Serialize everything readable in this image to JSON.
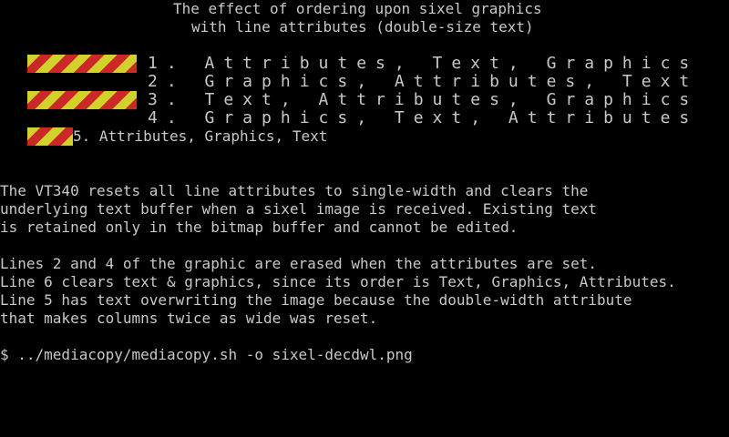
{
  "header": {
    "line1": "The effect of ordering upon sixel graphics",
    "line2": "with line attributes (double-size text)"
  },
  "demo": {
    "line1": "1. Attributes, Text, Graphics",
    "line2": "2. Graphics, Attributes, Text",
    "line3": "3. Text, Attributes, Graphics",
    "line4": "4. Graphics, Text, Attributes",
    "line5": "5. Attributes, Graphics, Text"
  },
  "explanation": {
    "p1": [
      "The VT340 resets all line attributes to single-width and clears the",
      "underlying text buffer when a sixel image is received. Existing text",
      "is retained only in the bitmap buffer and cannot be edited."
    ],
    "p2": [
      "Lines 2 and 4 of the graphic are erased when the attributes are set.",
      "Line 6 clears text & graphics, since its order is Text, Graphics, Attributes.",
      "Line 5 has text overwriting the image because the double-width attribute",
      "that makes columns twice as wide was reset."
    ]
  },
  "prompt": {
    "text": "$ ../mediacopy/mediacopy.sh -o sixel-decdwl.png"
  },
  "colors": {
    "background": "#000000",
    "text": "#c8c8c8",
    "stripe_yellow": "#d2d22a",
    "stripe_red": "#cc2828"
  }
}
